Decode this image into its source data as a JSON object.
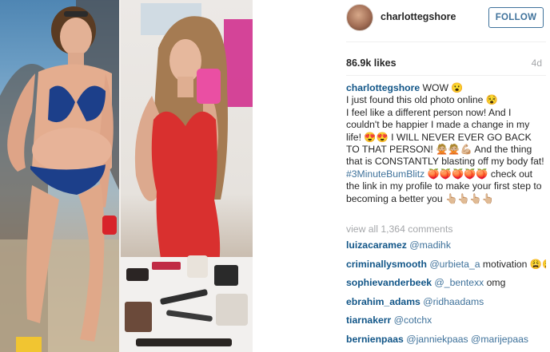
{
  "post": {
    "username": "charlottegshore",
    "follow_label": "FOLLOW",
    "likes": "86.9k likes",
    "time_ago": "4d"
  },
  "caption": {
    "username": "charlottegshore",
    "text_1": " WOW 😮\nI just found this old photo online 😵\nI feel like a different person now! And I couldn't be happier I made a change in my life! 😍😍 I WILL NEVER EVER GO BACK TO THAT PERSON! 🙅🏼🙅🏼💪🏼 And the thing that is CONSTANTLY blasting off my body fat! ",
    "hashtag": "#3MinuteBumBlitz",
    "text_2": " 🍑🍑🍑🍑🍑 check out the link in my profile to make your first step to becoming a better you 👆🏼👆🏼👆🏼👆🏼"
  },
  "view_all_comments": "view all 1,364 comments",
  "comments": [
    {
      "user": "luizacaramez",
      "mentions": [
        "@madihk"
      ],
      "text": ""
    },
    {
      "user": "criminallysmooth",
      "mentions": [
        "@urbieta_a"
      ],
      "text": "motivation 😩😩🖤🖤"
    },
    {
      "user": "sophievanderbeek",
      "mentions": [
        "@_bentexx"
      ],
      "text": "omg"
    },
    {
      "user": "ebrahim_adams",
      "mentions": [
        "@ridhaadams"
      ],
      "text": ""
    },
    {
      "user": "tiarnakerr",
      "mentions": [
        "@cotchx"
      ],
      "text": ""
    },
    {
      "user": "bernienpaas",
      "mentions": [
        "@janniekpaas",
        "@marijepaas"
      ],
      "text": ""
    }
  ],
  "colors": {
    "username": "#125688",
    "link": "#3f729b",
    "muted": "#a5a7aa",
    "follow_border": "#3f729b"
  },
  "photo": {
    "description_icon": "before-after-photo"
  }
}
